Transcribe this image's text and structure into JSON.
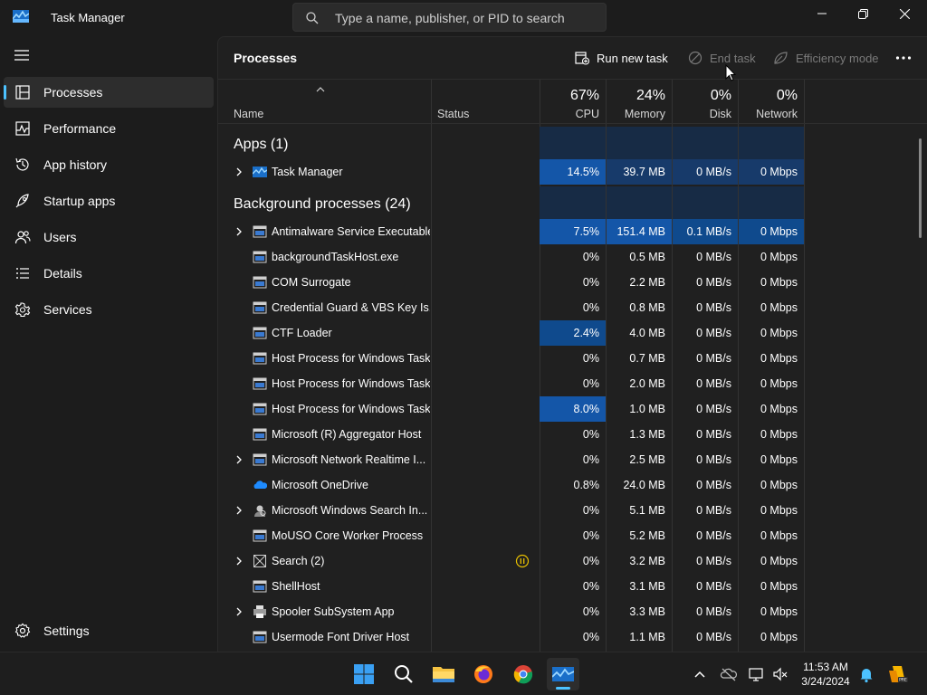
{
  "window": {
    "title": "Task Manager",
    "search_placeholder": "Type a name, publisher, or PID to search"
  },
  "sidebar": {
    "items": [
      {
        "label": "Processes",
        "icon": "processes-icon",
        "active": true
      },
      {
        "label": "Performance",
        "icon": "performance-icon"
      },
      {
        "label": "App history",
        "icon": "app-history-icon"
      },
      {
        "label": "Startup apps",
        "icon": "startup-apps-icon"
      },
      {
        "label": "Users",
        "icon": "users-icon"
      },
      {
        "label": "Details",
        "icon": "details-icon"
      },
      {
        "label": "Services",
        "icon": "services-icon"
      }
    ],
    "settings_label": "Settings"
  },
  "toolbar": {
    "page_title": "Processes",
    "run_new_task": "Run new task",
    "end_task": "End task",
    "efficiency_mode": "Efficiency mode"
  },
  "columns": {
    "name": "Name",
    "status": "Status",
    "cpu": {
      "pct": "67%",
      "label": "CPU"
    },
    "memory": {
      "pct": "24%",
      "label": "Memory"
    },
    "disk": {
      "pct": "0%",
      "label": "Disk"
    },
    "network": {
      "pct": "0%",
      "label": "Network"
    }
  },
  "groups": {
    "apps": "Apps (1)",
    "background": "Background processes (24)"
  },
  "apps": [
    {
      "name": "Task Manager",
      "cpu": "14.5%",
      "memory": "39.7 MB",
      "disk": "0 MB/s",
      "network": "0 Mbps",
      "expandable": true,
      "icon": "task-manager-icon"
    }
  ],
  "processes": [
    {
      "name": "Antimalware Service Executable",
      "cpu": "7.5%",
      "memory": "151.4 MB",
      "disk": "0.1 MB/s",
      "network": "0 Mbps",
      "expandable": true,
      "icon": "window-icon"
    },
    {
      "name": "backgroundTaskHost.exe",
      "cpu": "0%",
      "memory": "0.5 MB",
      "disk": "0 MB/s",
      "network": "0 Mbps",
      "icon": "window-icon"
    },
    {
      "name": "COM Surrogate",
      "cpu": "0%",
      "memory": "2.2 MB",
      "disk": "0 MB/s",
      "network": "0 Mbps",
      "icon": "window-icon"
    },
    {
      "name": "Credential Guard & VBS Key Is...",
      "cpu": "0%",
      "memory": "0.8 MB",
      "disk": "0 MB/s",
      "network": "0 Mbps",
      "icon": "window-icon"
    },
    {
      "name": "CTF Loader",
      "cpu": "2.4%",
      "memory": "4.0 MB",
      "disk": "0 MB/s",
      "network": "0 Mbps",
      "icon": "window-icon"
    },
    {
      "name": "Host Process for Windows Tasks",
      "cpu": "0%",
      "memory": "0.7 MB",
      "disk": "0 MB/s",
      "network": "0 Mbps",
      "icon": "window-icon"
    },
    {
      "name": "Host Process for Windows Tasks",
      "cpu": "0%",
      "memory": "2.0 MB",
      "disk": "0 MB/s",
      "network": "0 Mbps",
      "icon": "window-icon"
    },
    {
      "name": "Host Process for Windows Tasks",
      "cpu": "8.0%",
      "memory": "1.0 MB",
      "disk": "0 MB/s",
      "network": "0 Mbps",
      "icon": "window-icon"
    },
    {
      "name": "Microsoft (R) Aggregator Host",
      "cpu": "0%",
      "memory": "1.3 MB",
      "disk": "0 MB/s",
      "network": "0 Mbps",
      "icon": "window-icon"
    },
    {
      "name": "Microsoft Network Realtime I...",
      "cpu": "0%",
      "memory": "2.5 MB",
      "disk": "0 MB/s",
      "network": "0 Mbps",
      "expandable": true,
      "icon": "window-icon"
    },
    {
      "name": "Microsoft OneDrive",
      "cpu": "0.8%",
      "memory": "24.0 MB",
      "disk": "0 MB/s",
      "network": "0 Mbps",
      "icon": "onedrive-icon"
    },
    {
      "name": "Microsoft Windows Search In...",
      "cpu": "0%",
      "memory": "5.1 MB",
      "disk": "0 MB/s",
      "network": "0 Mbps",
      "expandable": true,
      "icon": "search-indexer-icon"
    },
    {
      "name": "MoUSO Core Worker Process",
      "cpu": "0%",
      "memory": "5.2 MB",
      "disk": "0 MB/s",
      "network": "0 Mbps",
      "icon": "window-icon"
    },
    {
      "name": "Search (2)",
      "cpu": "0%",
      "memory": "3.2 MB",
      "disk": "0 MB/s",
      "network": "0 Mbps",
      "expandable": true,
      "icon": "search-app-icon",
      "status": "suspended"
    },
    {
      "name": "ShellHost",
      "cpu": "0%",
      "memory": "3.1 MB",
      "disk": "0 MB/s",
      "network": "0 Mbps",
      "icon": "window-icon"
    },
    {
      "name": "Spooler SubSystem App",
      "cpu": "0%",
      "memory": "3.3 MB",
      "disk": "0 MB/s",
      "network": "0 Mbps",
      "expandable": true,
      "icon": "printer-icon"
    },
    {
      "name": "Usermode Font Driver Host",
      "cpu": "0%",
      "memory": "1.1 MB",
      "disk": "0 MB/s",
      "network": "0 Mbps",
      "icon": "window-icon"
    }
  ],
  "taskbar": {
    "apps": [
      "start-icon",
      "search-icon",
      "file-explorer-icon",
      "firefox-icon",
      "chrome-icon",
      "task-manager-icon"
    ],
    "time": "11:53 AM",
    "date": "3/24/2024"
  },
  "colors": {
    "accent": "#4cc2ff",
    "heat_low": "#173a6a",
    "heat_mid": "#0f4a8d",
    "heat_high": "#1456a8"
  }
}
